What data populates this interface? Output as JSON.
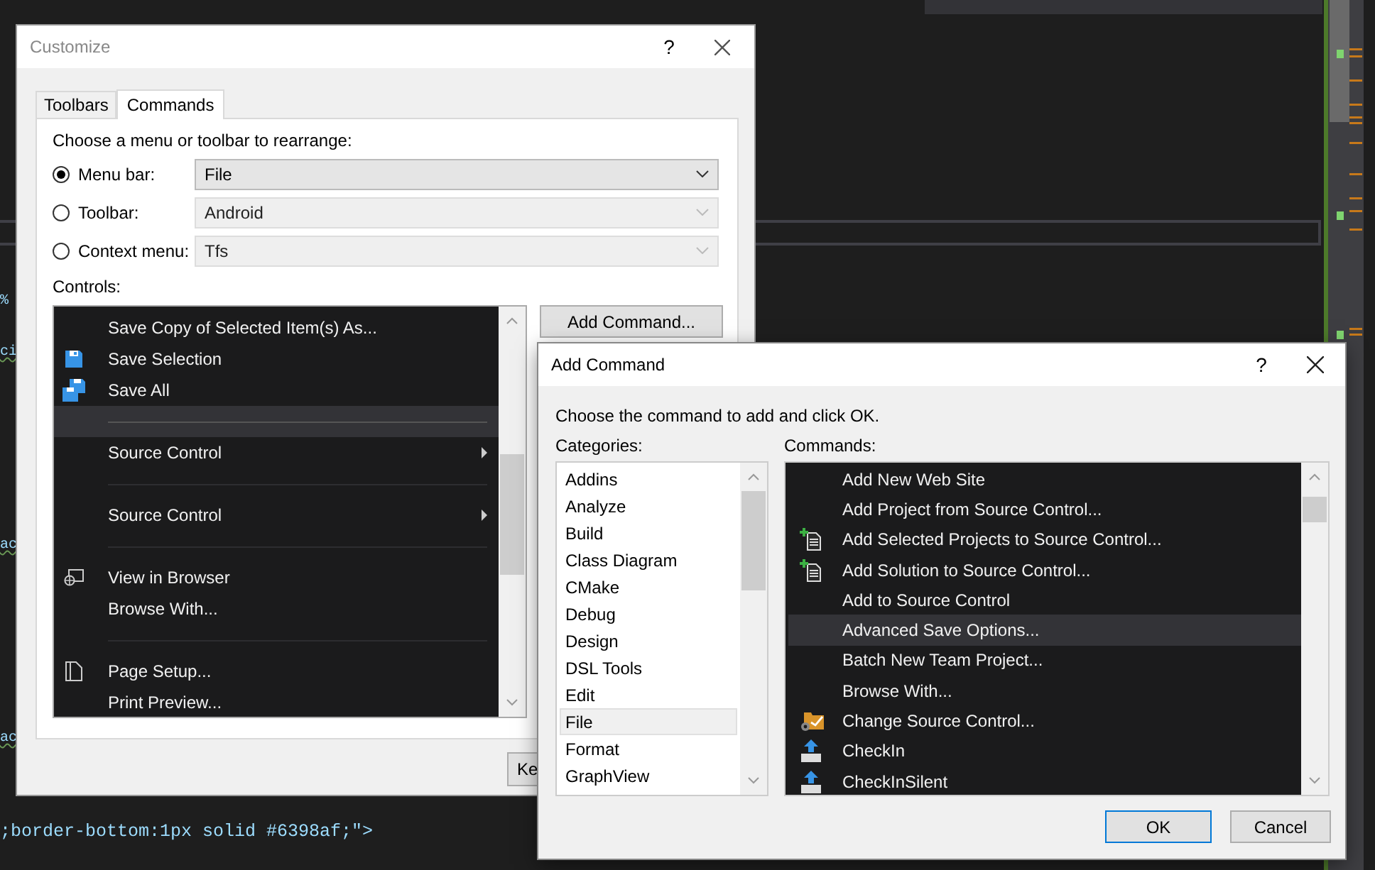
{
  "editor": {
    "code_fragments": [
      "%",
      "ci",
      "ac",
      "ac"
    ],
    "code_line": ";border-bottom:1px solid #6398af;\">"
  },
  "customize": {
    "title": "Customize",
    "help": "?",
    "tabs": [
      {
        "label": "Toolbars",
        "selected": false
      },
      {
        "label": "Commands",
        "selected": true
      }
    ],
    "prompt": "Choose a menu or toolbar to rearrange:",
    "targets": [
      {
        "label": "Menu bar:",
        "selected": true,
        "value": "File",
        "disabled": false
      },
      {
        "label": "Toolbar:",
        "selected": false,
        "value": "Android",
        "disabled": true
      },
      {
        "label": "Context menu:",
        "selected": false,
        "value": "Tfs",
        "disabled": true
      }
    ],
    "controls_label": "Controls:",
    "controls": [
      {
        "kind": "plain",
        "label": "Save Copy of Selected Item(s) As...",
        "selected": false
      },
      {
        "kind": "floppy",
        "label": "Save Selection",
        "selected": false
      },
      {
        "kind": "floppies",
        "label": "Save All",
        "selected": false
      },
      {
        "kind": "separator",
        "selected": true
      },
      {
        "kind": "submenu",
        "label": "Source Control",
        "selected": false
      },
      {
        "kind": "separator",
        "selected": false
      },
      {
        "kind": "submenu",
        "label": "Source Control",
        "selected": false
      },
      {
        "kind": "separator",
        "selected": false
      },
      {
        "kind": "browser",
        "label": "View in Browser",
        "selected": false
      },
      {
        "kind": "plain",
        "label": "Browse With...",
        "selected": false
      },
      {
        "kind": "separator",
        "selected": false
      },
      {
        "kind": "page",
        "label": "Page Setup...",
        "selected": false
      },
      {
        "kind": "plain",
        "label": "Print Preview...",
        "selected": false
      }
    ],
    "add_button": "Add Command...",
    "bottom_button": "Ke"
  },
  "add_command": {
    "title": "Add Command",
    "help": "?",
    "prompt": "Choose the command to add and click OK.",
    "categories_label": "Categories:",
    "categories": [
      {
        "label": "Addins",
        "selected": false
      },
      {
        "label": "Analyze",
        "selected": false
      },
      {
        "label": "Build",
        "selected": false
      },
      {
        "label": "Class Diagram",
        "selected": false
      },
      {
        "label": "CMake",
        "selected": false
      },
      {
        "label": "Debug",
        "selected": false
      },
      {
        "label": "Design",
        "selected": false
      },
      {
        "label": "DSL Tools",
        "selected": false
      },
      {
        "label": "Edit",
        "selected": false
      },
      {
        "label": "File",
        "selected": true
      },
      {
        "label": "Format",
        "selected": false
      },
      {
        "label": "GraphView",
        "selected": false
      }
    ],
    "commands_label": "Commands:",
    "commands": [
      {
        "kind": "plain",
        "label": "Add New Web Site",
        "selected": false
      },
      {
        "kind": "plain",
        "label": "Add Project from Source Control...",
        "selected": false
      },
      {
        "kind": "add-doc",
        "label": "Add Selected Projects to Source Control...",
        "selected": false
      },
      {
        "kind": "add-doc",
        "label": "Add Solution to Source Control...",
        "selected": false
      },
      {
        "kind": "plain",
        "label": "Add to Source Control",
        "selected": false
      },
      {
        "kind": "plain",
        "label": "Advanced Save Options...",
        "selected": true
      },
      {
        "kind": "plain",
        "label": "Batch New Team Project...",
        "selected": false
      },
      {
        "kind": "plain",
        "label": "Browse With...",
        "selected": false
      },
      {
        "kind": "change-sc",
        "label": "Change Source Control...",
        "selected": false
      },
      {
        "kind": "checkin",
        "label": "CheckIn",
        "selected": false
      },
      {
        "kind": "checkin",
        "label": "CheckInSilent",
        "selected": false
      }
    ],
    "buttons": [
      "OK",
      "Cancel"
    ]
  }
}
